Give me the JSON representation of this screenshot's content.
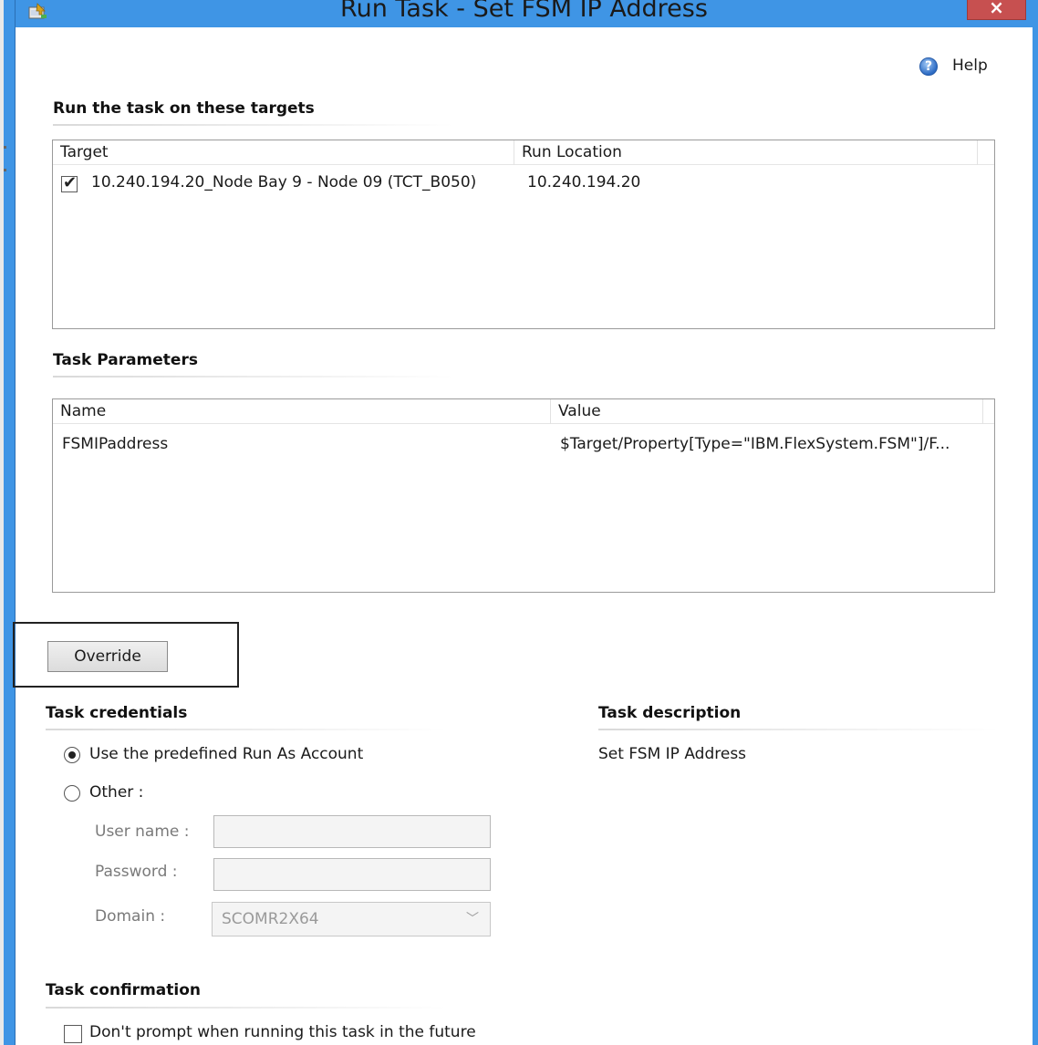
{
  "window": {
    "title": "Run Task - Set FSM IP Address",
    "close_label": "×"
  },
  "help": {
    "label": "Help",
    "icon": "help-icon"
  },
  "targets_section": {
    "title": "Run the task on these targets",
    "columns": [
      "Target",
      "Run Location"
    ],
    "rows": [
      {
        "checked": true,
        "target": "10.240.194.20_Node Bay 9 - Node 09 (TCT_B050)",
        "run_location": "10.240.194.20"
      }
    ]
  },
  "parameters_section": {
    "title": "Task Parameters",
    "columns": [
      "Name",
      "Value"
    ],
    "rows": [
      {
        "name": "FSMIPaddress",
        "value": "$Target/Property[Type=\"IBM.FlexSystem.FSM\"]/F..."
      }
    ]
  },
  "override_button": "Override",
  "credentials_section": {
    "title": "Task credentials",
    "option_predefined": "Use the predefined Run As Account",
    "option_other": "Other :",
    "selected": "predefined",
    "username_label": "User name :",
    "username_value": "",
    "password_label": "Password :",
    "password_value": "",
    "domain_label": "Domain :",
    "domain_value": "SCOMR2X64"
  },
  "description_section": {
    "title": "Task description",
    "text": "Set FSM IP Address"
  },
  "confirmation_section": {
    "title": "Task confirmation",
    "dont_prompt_label": "Don't prompt when running this task in the future",
    "dont_prompt_checked": false
  },
  "colors": {
    "accent": "#3f95e5",
    "close": "#c75050",
    "border": "#9a9a9a"
  }
}
